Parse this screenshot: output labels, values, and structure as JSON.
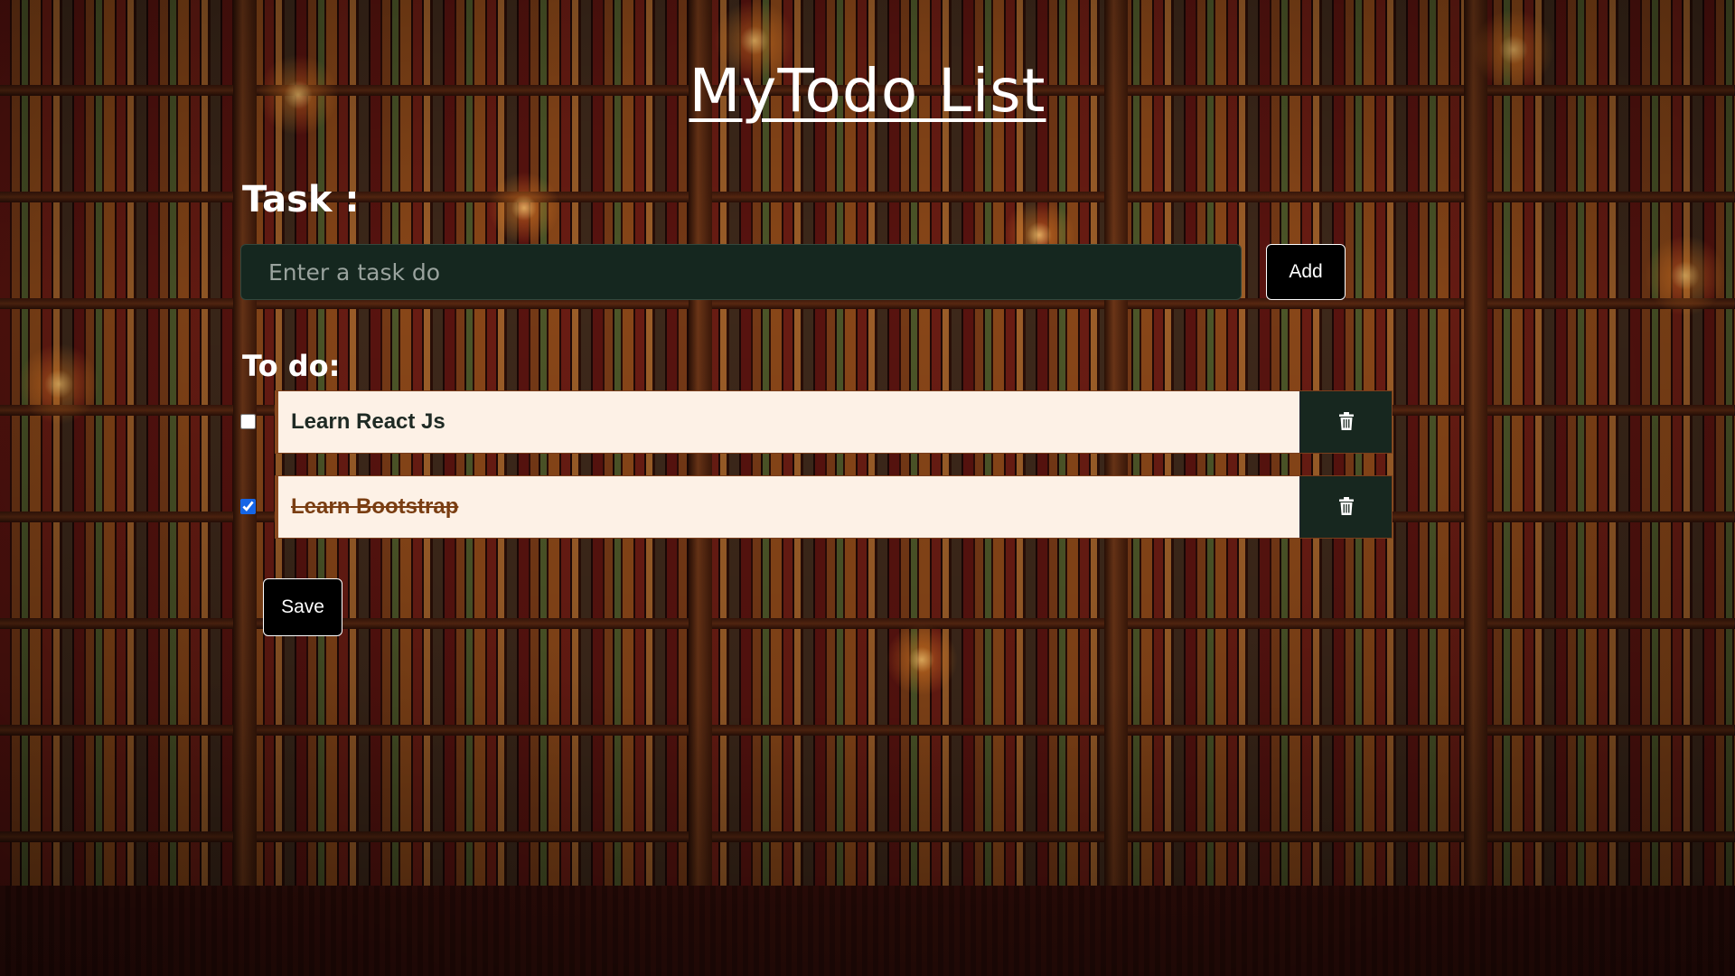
{
  "app": {
    "title": "MyTodo List",
    "task_label": "Task :",
    "task_input": {
      "value": "",
      "placeholder": "Enter a task do"
    },
    "add_label": "Add",
    "todo_label": "To do:",
    "todos": [
      {
        "text": "Learn React Js",
        "done": false
      },
      {
        "text": "Learn Bootstrap",
        "done": true
      }
    ],
    "save_label": "Save"
  },
  "icons": {
    "delete": "trash-icon"
  },
  "colors": {
    "input_bg": "#15271f",
    "item_bg": "#fdf1e6",
    "done_text": "#7a3e12",
    "checkbox_accent": "#1565e6"
  }
}
